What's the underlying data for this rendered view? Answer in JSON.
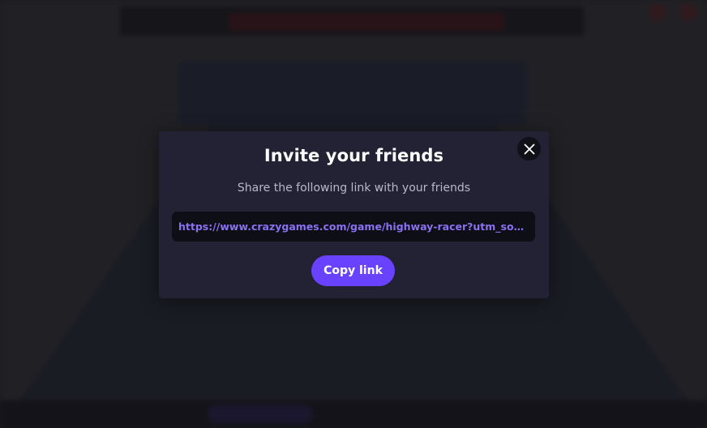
{
  "modal": {
    "title": "Invite your friends",
    "subtitle": "Share the following link with your friends",
    "share_link": "https://www.crazygames.com/game/highway-racer?utm_source=...",
    "copy_button_label": "Copy link",
    "close_icon": "close-icon"
  },
  "colors": {
    "modal_bg": "#222234",
    "link_text": "#8c70f2",
    "accent_button": "#6842ff",
    "overlay": "#0c0c10"
  }
}
